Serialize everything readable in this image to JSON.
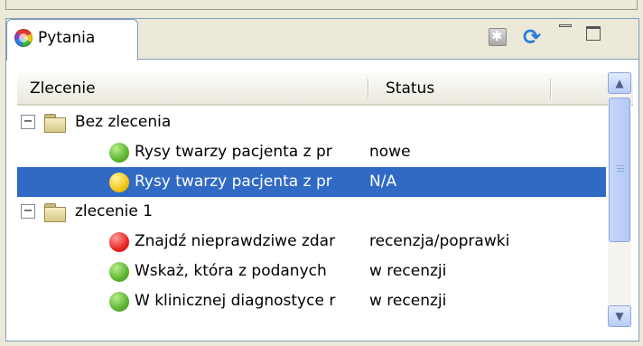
{
  "tab": {
    "label": "Pytania",
    "icon": "color-wheel-icon"
  },
  "toolbar": {
    "icons": [
      "asterisk-icon",
      "refresh-icon",
      "minimize-icon",
      "maximize-icon"
    ]
  },
  "table": {
    "columns": [
      "Zlecenie",
      "Status"
    ],
    "groups": [
      {
        "label": "Bez zlecenia",
        "expanded": true,
        "items": [
          {
            "name": "Rysy twarzy pacjenta z pr",
            "status": "nowe",
            "state": "green",
            "selected": false
          },
          {
            "name": "Rysy twarzy pacjenta z pr",
            "status": "N/A",
            "state": "yellow",
            "selected": true
          }
        ]
      },
      {
        "label": "zlecenie 1",
        "expanded": true,
        "items": [
          {
            "name": "Znajdź nieprawdziwe zdar",
            "status": "recenzja/poprawki",
            "state": "red",
            "selected": false
          },
          {
            "name": "Wskaż, która z podanych",
            "status": "w recenzji",
            "state": "green",
            "selected": false
          },
          {
            "name": "W klinicznej diagnostyce r",
            "status": "w recenzji",
            "state": "green",
            "selected": false
          }
        ]
      }
    ]
  },
  "colors": {
    "selection": "#316ac5",
    "border": "#7f9db9",
    "background": "#ece9d8"
  }
}
